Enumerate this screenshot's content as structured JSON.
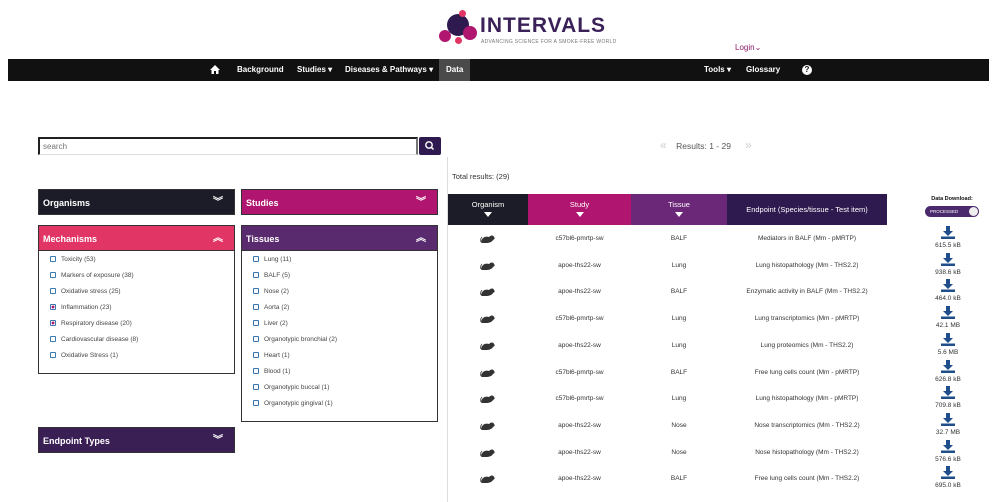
{
  "brand": {
    "name": "INTERVALS",
    "tagline": "ADVANCING SCIENCE FOR A SMOKE-FREE WORLD",
    "colors": {
      "primary": "#2e1a4f",
      "accent": "#b0166f",
      "pink": "#e03565"
    }
  },
  "login_label": "Login",
  "nav": {
    "home_icon": "home-icon",
    "items": [
      "Background",
      "Studies",
      "Diseases & Pathways",
      "Data"
    ],
    "right_items": [
      "Tools",
      "Glossary"
    ],
    "help_icon": "question-circle-icon",
    "active": "Data"
  },
  "search": {
    "placeholder": "search"
  },
  "panels": {
    "organisms": {
      "title": "Organisms",
      "color": "#1c1c28"
    },
    "studies": {
      "title": "Studies",
      "color": "#b0166f"
    },
    "mechanisms": {
      "title": "Mechanisms",
      "color": "#e03565",
      "items": [
        {
          "label": "Toxicity (53)",
          "checked": false
        },
        {
          "label": "Markers of exposure (38)",
          "checked": false
        },
        {
          "label": "Oxidative stress (25)",
          "checked": false
        },
        {
          "label": "Inflammation (23)",
          "checked": true
        },
        {
          "label": "Respiratory disease (20)",
          "checked": true
        },
        {
          "label": "Cardiovascular disease (8)",
          "checked": false
        },
        {
          "label": "Oxidative Stress (1)",
          "checked": false
        }
      ]
    },
    "tissues": {
      "title": "Tissues",
      "color": "#5a2a6e",
      "items": [
        {
          "label": "Lung (11)"
        },
        {
          "label": "BALF (5)"
        },
        {
          "label": "Nose (2)"
        },
        {
          "label": "Aorta (2)"
        },
        {
          "label": "Liver (2)"
        },
        {
          "label": "Organotypic bronchial (2)"
        },
        {
          "label": "Heart (1)"
        },
        {
          "label": "Blood (1)"
        },
        {
          "label": "Organotypic buccal (1)"
        },
        {
          "label": "Organotypic gingival (1)"
        }
      ]
    },
    "endpoint_types": {
      "title": "Endpoint Types",
      "color": "#3a1f55"
    }
  },
  "results": {
    "pager_label": "Results: 1 - 29",
    "total_label": "Total results: (29)",
    "columns": [
      {
        "label": "Organism",
        "color": "#1c1c28"
      },
      {
        "label": "Study",
        "color": "#b0166f"
      },
      {
        "label": "Tissue",
        "color": "#6b2878"
      },
      {
        "label": "Endpoint (Species/tissue - Test item)",
        "color": "#2e1a4f"
      }
    ],
    "download_header": "Data Download:",
    "toggle_label": "PROCESSED",
    "rows": [
      {
        "study": "c57bl6-pmrtp-sw",
        "tissue": "BALF",
        "endpoint": "Mediators in BALF (Mm - pMRTP)",
        "size": "615.5 kB"
      },
      {
        "study": "apoe-ths22-sw",
        "tissue": "Lung",
        "endpoint": "Lung histopathology (Mm - THS2.2)",
        "size": "938.6 kB"
      },
      {
        "study": "apoe-ths22-sw",
        "tissue": "BALF",
        "endpoint": "Enzymatic activity in BALF (Mm - THS2.2)",
        "size": "464.0 kB"
      },
      {
        "study": "c57bl6-pmrtp-sw",
        "tissue": "Lung",
        "endpoint": "Lung transcriptomics (Mm - pMRTP)",
        "size": "42.1 MB"
      },
      {
        "study": "apoe-ths22-sw",
        "tissue": "Lung",
        "endpoint": "Lung proteomics (Mm - THS2.2)",
        "size": "5.6 MB"
      },
      {
        "study": "c57bl6-pmrtp-sw",
        "tissue": "BALF",
        "endpoint": "Free lung cells count (Mm - pMRTP)",
        "size": "626.8 kB"
      },
      {
        "study": "c57bl6-pmrtp-sw",
        "tissue": "Lung",
        "endpoint": "Lung histopathology (Mm - pMRTP)",
        "size": "709.8 kB"
      },
      {
        "study": "apoe-ths22-sw",
        "tissue": "Nose",
        "endpoint": "Nose transcriptomics (Mm - THS2.2)",
        "size": "32.7 MB"
      },
      {
        "study": "apoe-ths22-sw",
        "tissue": "Nose",
        "endpoint": "Nose histopathology (Mm - THS2.2)",
        "size": "576.6 kB"
      },
      {
        "study": "apoe-ths22-sw",
        "tissue": "BALF",
        "endpoint": "Free lung cells count (Mm - THS2.2)",
        "size": "695.0 kB"
      }
    ]
  }
}
